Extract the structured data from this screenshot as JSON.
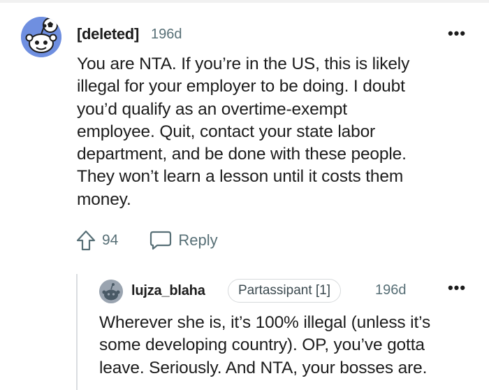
{
  "comment": {
    "author": "[deleted]",
    "age": "196d",
    "more_label": "•••",
    "avatar_icon": "snoo-avatar-icon",
    "body_lines": [
      "You are NTA. If you’re in the US, this is likely",
      "illegal for your employer to be doing. I doubt",
      "you’d qualify as an overtime-exempt",
      "employee. Quit, contact your state labor",
      "department, and be done with these people.",
      "They won’t learn a lesson until it costs them",
      "money."
    ],
    "upvote_icon": "upvote-arrow-icon",
    "vote_count": "94",
    "reply_icon": "speech-bubble-icon",
    "reply_label": "Reply"
  },
  "reply": {
    "author": "lujza_blaha",
    "flair": "Partassipant [1]",
    "age": "196d",
    "more_label": "•••",
    "avatar_icon": "user-avatar-icon",
    "body_lines": [
      "Wherever she is, it’s 100% illegal (unless it’s",
      "some developing country). OP, you’ve gotta",
      "leave. Seriously. And NTA, your bosses are."
    ]
  },
  "colors": {
    "text": "#1c1c1c",
    "meta": "#576f76",
    "avatar_bg": "#6f8fe0",
    "thread_line": "#dadde0"
  }
}
